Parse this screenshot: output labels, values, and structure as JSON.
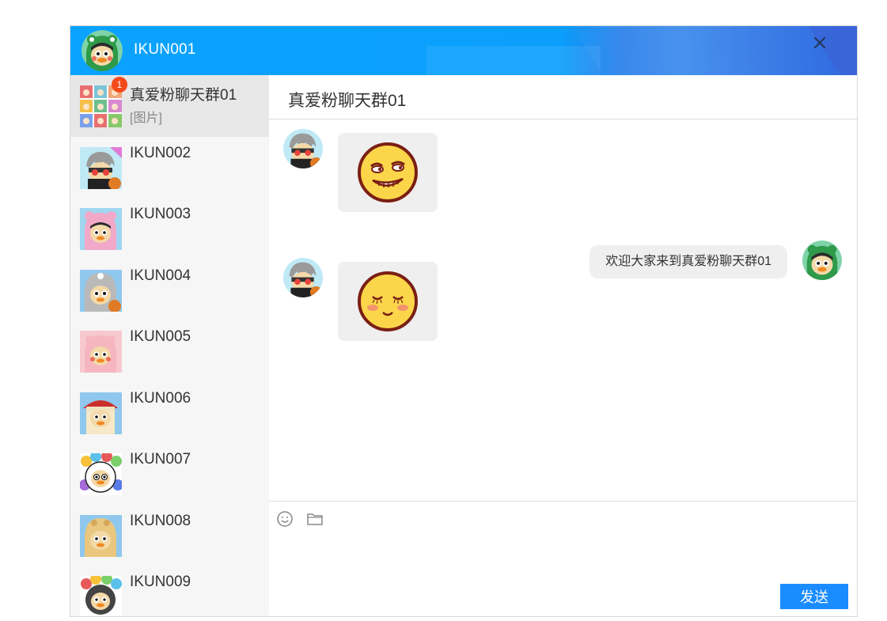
{
  "window": {
    "title": "IKUN001",
    "close_icon": "close-icon"
  },
  "sidebar": {
    "items": [
      {
        "name": "真爱粉聊天群01",
        "last_message": "[图片]",
        "unread": "1",
        "avatar": "group-grid-avatar",
        "active": true
      },
      {
        "name": "IKUN002",
        "last_message": "",
        "avatar": "gray-hair-avatar"
      },
      {
        "name": "IKUN003",
        "last_message": "",
        "avatar": "pink-hood-avatar"
      },
      {
        "name": "IKUN004",
        "last_message": "",
        "avatar": "gray-hood-avatar"
      },
      {
        "name": "IKUN005",
        "last_message": "",
        "avatar": "pig-hood-avatar"
      },
      {
        "name": "IKUN006",
        "last_message": "",
        "avatar": "red-hat-avatar"
      },
      {
        "name": "IKUN007",
        "last_message": "",
        "avatar": "flower-hood-avatar"
      },
      {
        "name": "IKUN008",
        "last_message": "",
        "avatar": "tan-hood-avatar"
      },
      {
        "name": "IKUN009",
        "last_message": "",
        "avatar": "flower-hood-avatar-2"
      }
    ]
  },
  "chat": {
    "title": "真爱粉聊天群01",
    "messages": [
      {
        "sender": "IKUN002",
        "type": "image",
        "content": "grinning-smirk-emoji",
        "side": "left"
      },
      {
        "sender": "IKUN001",
        "type": "text",
        "content": "欢迎大家来到真爱粉聊天群01",
        "side": "right"
      },
      {
        "sender": "IKUN002",
        "type": "image",
        "content": "blushing-content-emoji",
        "side": "left"
      }
    ]
  },
  "composer": {
    "tools": [
      "emoji-icon",
      "folder-icon"
    ],
    "send_label": "发送"
  },
  "colors": {
    "title_bar": "#0aa3ff",
    "send_button": "#1a8cff",
    "badge": "#f44a1b",
    "sidebar_bg": "#f6f6f6",
    "active_item": "#e7e7e7",
    "bubble": "#efefef"
  }
}
